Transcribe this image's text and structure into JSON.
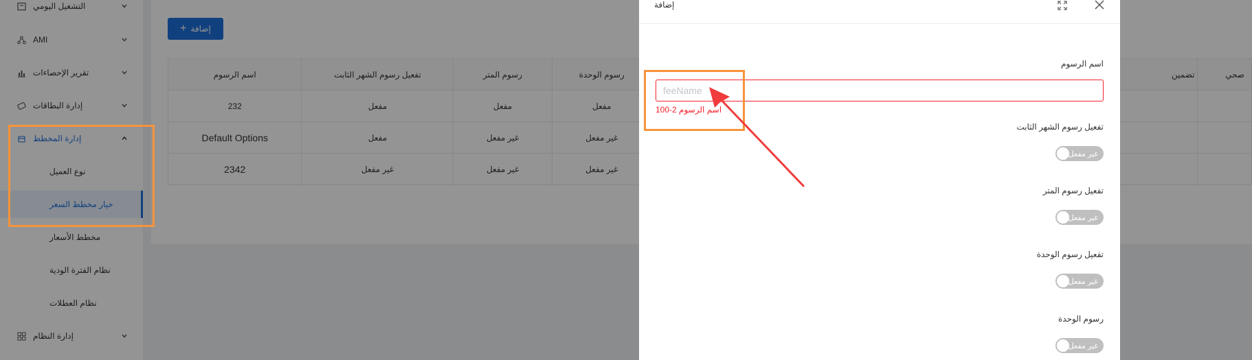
{
  "sidebar": {
    "items": [
      {
        "label": "التشغيل اليومي",
        "icon": "calendar-icon"
      },
      {
        "label": "AMI",
        "icon": "network-icon"
      },
      {
        "label": "تقرير الإحصاءات",
        "icon": "bar-chart-icon"
      },
      {
        "label": "إدارة البطاقات",
        "icon": "card-icon"
      },
      {
        "label": "إدارة المخطط",
        "icon": "box-icon"
      }
    ],
    "sub_items": [
      {
        "label": "نوع العميل"
      },
      {
        "label": "خيار مخطط السعر"
      },
      {
        "label": "مخطط الأسعار"
      },
      {
        "label": "نظام الفترة الودية"
      },
      {
        "label": "نظام العطلات"
      }
    ],
    "system_item": {
      "label": "إدارة النظام",
      "icon": "grid-icon"
    }
  },
  "main": {
    "add_button_label": "إضافة",
    "table": {
      "columns": [
        "اسم الرسوم",
        "تفعيل رسوم الشهر الثابت",
        "رسوم المتر",
        "رسوم الوحدة",
        "تضمين",
        "صحي"
      ],
      "rows": [
        [
          "232",
          "مفعل",
          "مفعل",
          "مفعل",
          "",
          ""
        ],
        [
          "Default Options",
          "مفعل",
          "غير مفعل",
          "غير مفعل",
          "",
          ""
        ],
        [
          "2342",
          "غير مفعل",
          "غير مفعل",
          "غير مفعل",
          "",
          ""
        ]
      ]
    }
  },
  "drawer": {
    "title": "إضافة",
    "expand_icon": "expand-icon",
    "close_icon": "close-icon",
    "fields": {
      "fee_name_label": "اسم الرسوم",
      "fee_name_placeholder": "feeName",
      "fee_name_value": "",
      "fee_name_error": "100-2 اسم الرسوم",
      "monthly_fee_label": "تفعيل رسوم الشهر الثابت",
      "meter_fee_label": "تفعيل رسوم المتر",
      "unit_fee_label": "تفعيل رسوم الوحدة",
      "unit_fees_label": "رسوم الوحدة"
    },
    "switch_off_label": "غير مفعل"
  },
  "colors": {
    "primary": "#1e6fd9",
    "error": "#f5222d",
    "annotation": "#f7933b",
    "arrow": "#f03c3c"
  }
}
